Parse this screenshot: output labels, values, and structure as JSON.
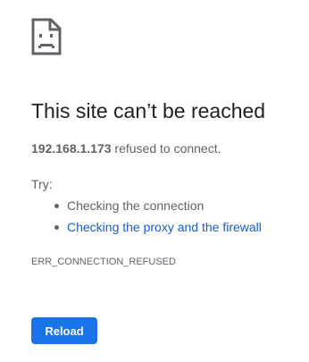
{
  "icon": "sad-page-icon",
  "title": "This site can’t be reached",
  "description": {
    "host": "192.168.1.173",
    "message": " refused to connect."
  },
  "try_label": "Try:",
  "suggestions": [
    {
      "label": "Checking the connection",
      "link": false
    },
    {
      "label": "Checking the proxy and the firewall",
      "link": true
    }
  ],
  "error_code": "ERR_CONNECTION_REFUSED",
  "reload_label": "Reload",
  "colors": {
    "accent": "#1a73e8",
    "link": "#1a5cc8",
    "text": "#202124",
    "secondary_text": "#5f6368"
  }
}
